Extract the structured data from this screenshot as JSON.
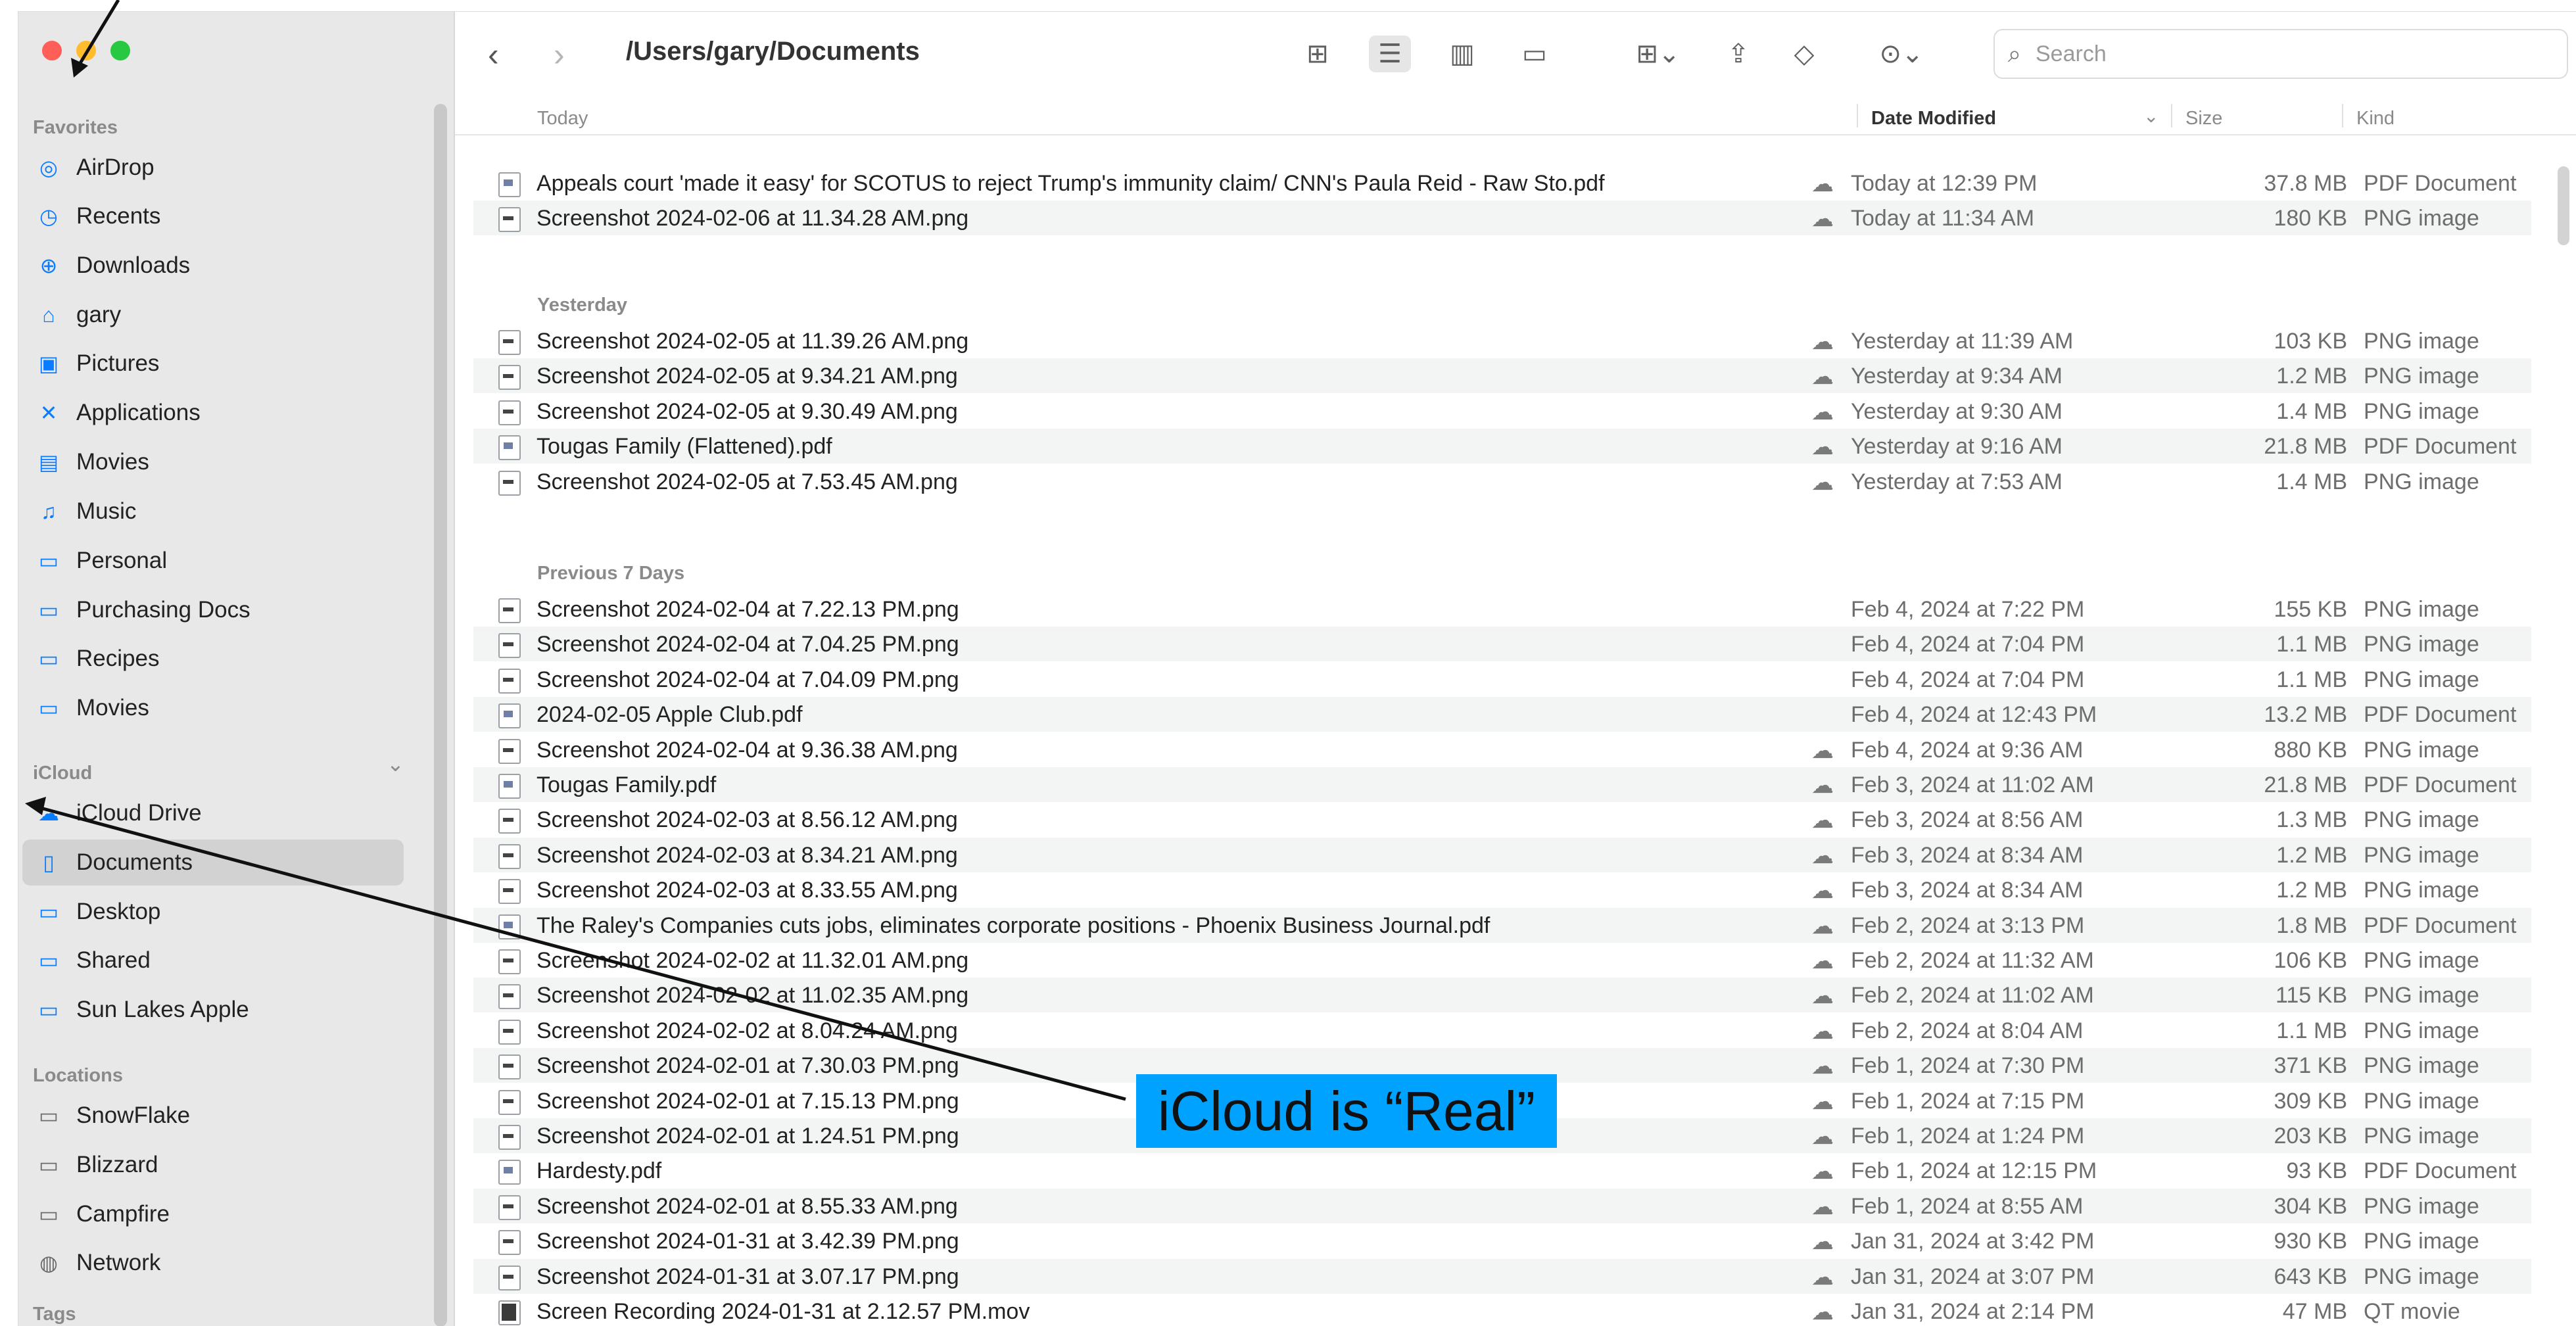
{
  "window": {
    "path": "/Users/gary/Documents"
  },
  "sidebar": {
    "sections": {
      "favorites": "Favorites",
      "icloud": "iCloud",
      "locations": "Locations",
      "tags": "Tags"
    },
    "favorites": [
      {
        "label": "AirDrop",
        "icon": "airdrop-icon"
      },
      {
        "label": "Recents",
        "icon": "clock-icon"
      },
      {
        "label": "Downloads",
        "icon": "download-icon"
      },
      {
        "label": "gary",
        "icon": "home-icon"
      },
      {
        "label": "Pictures",
        "icon": "photo-icon"
      },
      {
        "label": "Applications",
        "icon": "applications-icon"
      },
      {
        "label": "Movies",
        "icon": "film-icon"
      },
      {
        "label": "Music",
        "icon": "music-icon"
      },
      {
        "label": "Personal",
        "icon": "folder-icon"
      },
      {
        "label": "Purchasing Docs",
        "icon": "folder-icon"
      },
      {
        "label": "Recipes",
        "icon": "folder-icon"
      },
      {
        "label": "Movies",
        "icon": "folder-icon"
      }
    ],
    "icloud": [
      {
        "label": "iCloud Drive",
        "icon": "cloud-icon"
      },
      {
        "label": "Documents",
        "icon": "document-icon",
        "active": true
      },
      {
        "label": "Desktop",
        "icon": "desktop-icon"
      },
      {
        "label": "Shared",
        "icon": "shared-folder-icon"
      },
      {
        "label": "Sun Lakes Apple",
        "icon": "folder-icon"
      }
    ],
    "locations": [
      {
        "label": "SnowFlake",
        "icon": "laptop-icon"
      },
      {
        "label": "Blizzard",
        "icon": "drive-icon"
      },
      {
        "label": "Campfire",
        "icon": "display-icon"
      },
      {
        "label": "Network",
        "icon": "globe-icon"
      }
    ]
  },
  "toolbar": {
    "search_placeholder": "Search"
  },
  "columns": {
    "name": "Today",
    "date": "Date Modified",
    "size": "Size",
    "kind": "Kind"
  },
  "groups": [
    {
      "title": "Today",
      "rows": [
        {
          "name": "Appeals court 'made it easy' for SCOTUS to reject Trump's immunity claim/ CNN's Paula Reid - Raw Sto.pdf",
          "date": "Today at 12:39 PM",
          "size": "37.8 MB",
          "kind": "PDF Document",
          "type": "pdf",
          "cloud": true
        },
        {
          "name": "Screenshot 2024-02-06 at 11.34.28 AM.png",
          "date": "Today at 11:34 AM",
          "size": "180 KB",
          "kind": "PNG image",
          "type": "png",
          "cloud": true
        }
      ]
    },
    {
      "title": "Yesterday",
      "rows": [
        {
          "name": "Screenshot 2024-02-05 at 11.39.26 AM.png",
          "date": "Yesterday at 11:39 AM",
          "size": "103 KB",
          "kind": "PNG image",
          "type": "png",
          "cloud": true
        },
        {
          "name": "Screenshot 2024-02-05 at 9.34.21 AM.png",
          "date": "Yesterday at 9:34 AM",
          "size": "1.2 MB",
          "kind": "PNG image",
          "type": "png",
          "cloud": true
        },
        {
          "name": "Screenshot 2024-02-05 at 9.30.49 AM.png",
          "date": "Yesterday at 9:30 AM",
          "size": "1.4 MB",
          "kind": "PNG image",
          "type": "png",
          "cloud": true
        },
        {
          "name": "Tougas Family (Flattened).pdf",
          "date": "Yesterday at 9:16 AM",
          "size": "21.8 MB",
          "kind": "PDF Document",
          "type": "pdf",
          "cloud": true
        },
        {
          "name": "Screenshot 2024-02-05 at 7.53.45 AM.png",
          "date": "Yesterday at 7:53 AM",
          "size": "1.4 MB",
          "kind": "PNG image",
          "type": "png",
          "cloud": true
        }
      ]
    },
    {
      "title": "Previous 7 Days",
      "rows": [
        {
          "name": "Screenshot 2024-02-04 at 7.22.13 PM.png",
          "date": "Feb 4, 2024 at 7:22 PM",
          "size": "155 KB",
          "kind": "PNG image",
          "type": "png",
          "cloud": false
        },
        {
          "name": "Screenshot 2024-02-04 at 7.04.25 PM.png",
          "date": "Feb 4, 2024 at 7:04 PM",
          "size": "1.1 MB",
          "kind": "PNG image",
          "type": "png",
          "cloud": false
        },
        {
          "name": "Screenshot 2024-02-04 at 7.04.09 PM.png",
          "date": "Feb 4, 2024 at 7:04 PM",
          "size": "1.1 MB",
          "kind": "PNG image",
          "type": "png",
          "cloud": false
        },
        {
          "name": "2024-02-05 Apple Club.pdf",
          "date": "Feb 4, 2024 at 12:43 PM",
          "size": "13.2 MB",
          "kind": "PDF Document",
          "type": "pdf",
          "cloud": false
        },
        {
          "name": "Screenshot 2024-02-04 at 9.36.38 AM.png",
          "date": "Feb 4, 2024 at 9:36 AM",
          "size": "880 KB",
          "kind": "PNG image",
          "type": "png",
          "cloud": true
        },
        {
          "name": "Tougas Family.pdf",
          "date": "Feb 3, 2024 at 11:02 AM",
          "size": "21.8 MB",
          "kind": "PDF Document",
          "type": "pdf",
          "cloud": true
        },
        {
          "name": "Screenshot 2024-02-03 at 8.56.12 AM.png",
          "date": "Feb 3, 2024 at 8:56 AM",
          "size": "1.3 MB",
          "kind": "PNG image",
          "type": "png",
          "cloud": true
        },
        {
          "name": "Screenshot 2024-02-03 at 8.34.21 AM.png",
          "date": "Feb 3, 2024 at 8:34 AM",
          "size": "1.2 MB",
          "kind": "PNG image",
          "type": "png",
          "cloud": true
        },
        {
          "name": "Screenshot 2024-02-03 at 8.33.55 AM.png",
          "date": "Feb 3, 2024 at 8:34 AM",
          "size": "1.2 MB",
          "kind": "PNG image",
          "type": "png",
          "cloud": true
        },
        {
          "name": "The Raley's Companies cuts jobs, eliminates corporate positions - Phoenix Business Journal.pdf",
          "date": "Feb 2, 2024 at 3:13 PM",
          "size": "1.8 MB",
          "kind": "PDF Document",
          "type": "pdf",
          "cloud": true
        },
        {
          "name": "Screenshot 2024-02-02 at 11.32.01 AM.png",
          "date": "Feb 2, 2024 at 11:32 AM",
          "size": "106 KB",
          "kind": "PNG image",
          "type": "png",
          "cloud": true
        },
        {
          "name": "Screenshot 2024-02-02 at 11.02.35 AM.png",
          "date": "Feb 2, 2024 at 11:02 AM",
          "size": "115 KB",
          "kind": "PNG image",
          "type": "png",
          "cloud": true
        },
        {
          "name": "Screenshot 2024-02-02 at 8.04.24 AM.png",
          "date": "Feb 2, 2024 at 8:04 AM",
          "size": "1.1 MB",
          "kind": "PNG image",
          "type": "png",
          "cloud": true
        },
        {
          "name": "Screenshot 2024-02-01 at 7.30.03 PM.png",
          "date": "Feb 1, 2024 at 7:30 PM",
          "size": "371 KB",
          "kind": "PNG image",
          "type": "png",
          "cloud": true
        },
        {
          "name": "Screenshot 2024-02-01 at 7.15.13 PM.png",
          "date": "Feb 1, 2024 at 7:15 PM",
          "size": "309 KB",
          "kind": "PNG image",
          "type": "png",
          "cloud": true
        },
        {
          "name": "Screenshot 2024-02-01 at 1.24.51 PM.png",
          "date": "Feb 1, 2024 at 1:24 PM",
          "size": "203 KB",
          "kind": "PNG image",
          "type": "png",
          "cloud": true
        },
        {
          "name": "Hardesty.pdf",
          "date": "Feb 1, 2024 at 12:15 PM",
          "size": "93 KB",
          "kind": "PDF Document",
          "type": "pdf",
          "cloud": true
        },
        {
          "name": "Screenshot 2024-02-01 at 8.55.33 AM.png",
          "date": "Feb 1, 2024 at 8:55 AM",
          "size": "304 KB",
          "kind": "PNG image",
          "type": "png",
          "cloud": true
        },
        {
          "name": "Screenshot 2024-01-31 at 3.42.39 PM.png",
          "date": "Jan 31, 2024 at 3:42 PM",
          "size": "930 KB",
          "kind": "PNG image",
          "type": "png",
          "cloud": true
        },
        {
          "name": "Screenshot 2024-01-31 at 3.07.17 PM.png",
          "date": "Jan 31, 2024 at 3:07 PM",
          "size": "643 KB",
          "kind": "PNG image",
          "type": "png",
          "cloud": true
        },
        {
          "name": "Screen Recording 2024-01-31 at 2.12.57 PM.mov",
          "date": "Jan 31, 2024 at 2:14 PM",
          "size": "47 MB",
          "kind": "QT movie",
          "type": "mov",
          "cloud": true
        }
      ]
    }
  ],
  "annotation": {
    "callout_text": "iCloud is “Real”",
    "callout_color": "#00a2ff"
  }
}
